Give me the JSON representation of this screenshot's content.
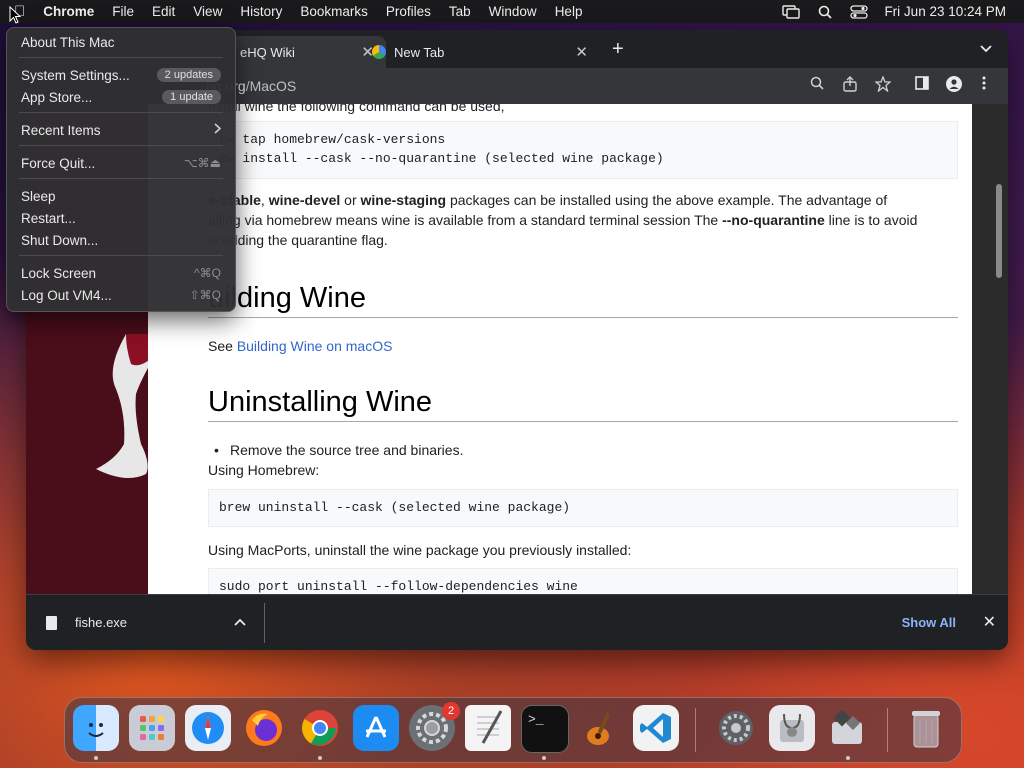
{
  "menubar": {
    "apple_icon": "apple-logo-icon",
    "app_name": "Chrome",
    "menus": [
      "File",
      "Edit",
      "View",
      "History",
      "Bookmarks",
      "Profiles",
      "Tab",
      "Window",
      "Help"
    ],
    "status_icons": [
      "screen-mirroring-icon",
      "spotlight-search-icon",
      "control-center-icon"
    ],
    "clock": "Fri Jun 23  10:24 PM"
  },
  "apple_menu": {
    "items": [
      {
        "label": "About This Mac"
      },
      {
        "label": "System Settings...",
        "badge": "2 updates"
      },
      {
        "label": "App Store...",
        "badge": "1 update"
      },
      {
        "label": "Recent Items",
        "submenu_icon": "chevron-right-icon"
      },
      {
        "label": "Force Quit...",
        "shortcut": "⌥⌘⏏"
      },
      {
        "label": "Sleep"
      },
      {
        "label": "Restart..."
      },
      {
        "label": "Shut Down..."
      },
      {
        "label": "Lock Screen",
        "shortcut": "^⌘Q"
      },
      {
        "label": "Log Out VM4...",
        "shortcut": "⇧⌘Q"
      }
    ]
  },
  "browser": {
    "tabs": [
      {
        "title": "eHQ Wiki",
        "active": true
      },
      {
        "title": "New Tab",
        "active": false
      }
    ],
    "new_tab_label": "+",
    "omnibox": {
      "host": "hq.org",
      "path": "/MacOS"
    },
    "toolbar_icons": [
      "zoom-icon",
      "share-icon",
      "bookmark-star-icon",
      "side-panel-icon",
      "profile-icon",
      "more-menu-icon"
    ]
  },
  "page": {
    "top_cut_text": "nstall wine the following command can be used,",
    "code1": [
      "ew tap homebrew/cask-versions",
      "ew install --cask --no-quarantine (selected wine package)"
    ],
    "para1": {
      "p1": "e-stable",
      "s1": ", ",
      "p2": "wine-devel",
      "s2": " or ",
      "p3": "wine-staging",
      "s3": " packages can be installed using the above example. The advantage of",
      "line2a": "alling via homebrew means wine is available from a standard terminal session The ",
      "line2b": "--no-quarantine",
      "line2c": " line is to avoid",
      "line3": "w adding the quarantine flag."
    },
    "heading1": "uilding Wine",
    "see_prefix": "See ",
    "see_link": "Building Wine on macOS",
    "heading2": "Uninstalling Wine",
    "bullet1": "Remove the source tree and binaries.",
    "using_homebrew": "Using Homebrew:",
    "code2": "brew uninstall --cask (selected wine package)",
    "using_macports": "Using MacPorts, uninstall the wine package you previously installed:",
    "code3": "sudo port uninstall --follow-dependencies wine"
  },
  "downloads_bar": {
    "file_name": "fishe.exe",
    "show_all": "Show All",
    "close": "✕"
  },
  "dock": {
    "apps": [
      "finder-icon",
      "launchpad-icon",
      "safari-icon",
      "firefox-icon",
      "chrome-icon",
      "app-store-icon",
      "system-preferences-icon",
      "textedit-icon",
      "terminal-icon",
      "garageband-icon",
      "vscode-icon",
      "system-settings-icon",
      "disk-utility-icon",
      "boot-camp-icon",
      "trash-icon"
    ],
    "system_preferences_badge": "2"
  }
}
